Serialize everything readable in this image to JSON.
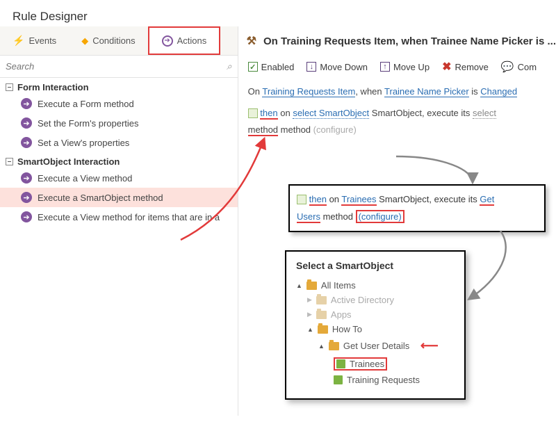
{
  "header": {
    "title": "Rule Designer"
  },
  "tabs": {
    "events": "Events",
    "conditions": "Conditions",
    "actions": "Actions"
  },
  "search": {
    "placeholder": "Search"
  },
  "groups": {
    "form": {
      "title": "Form Interaction",
      "items": [
        "Execute a Form method",
        "Set the Form's properties",
        "Set a View's properties"
      ]
    },
    "smartobject": {
      "title": "SmartObject Interaction",
      "items": [
        "Execute a View method",
        "Execute a SmartObject method",
        "Execute a View method for items that are in a"
      ]
    }
  },
  "rule": {
    "title": "On Training Requests Item, when Trainee Name Picker is ...",
    "toolbar": {
      "enabled": "Enabled",
      "movedown": "Move Down",
      "moveup": "Move Up",
      "remove": "Remove",
      "comments": "Com"
    },
    "line1": {
      "on": "On",
      "item": "Training Requests Item",
      "when": ", when",
      "picker": "Trainee Name Picker",
      "is": "is",
      "changed": "Changed"
    },
    "line2": {
      "then": "then",
      "on": "on",
      "sel": "select SmartObject",
      "so": "SmartObject, execute its",
      "selm": "select",
      "method": "method",
      "method2": "method",
      "cfg": "(configure)"
    }
  },
  "box1": {
    "then": "then",
    "on": "on",
    "trainees": "Trainees",
    "so": "SmartObject, execute its",
    "get": "Get",
    "users": "Users",
    "method": "method",
    "cfg": "(configure)"
  },
  "box2": {
    "title": "Select a SmartObject",
    "all": "All Items",
    "ad": "Active Directory",
    "apps": "Apps",
    "howto": "How To",
    "gud": "Get User Details",
    "trainees": "Trainees",
    "tr": "Training Requests"
  }
}
